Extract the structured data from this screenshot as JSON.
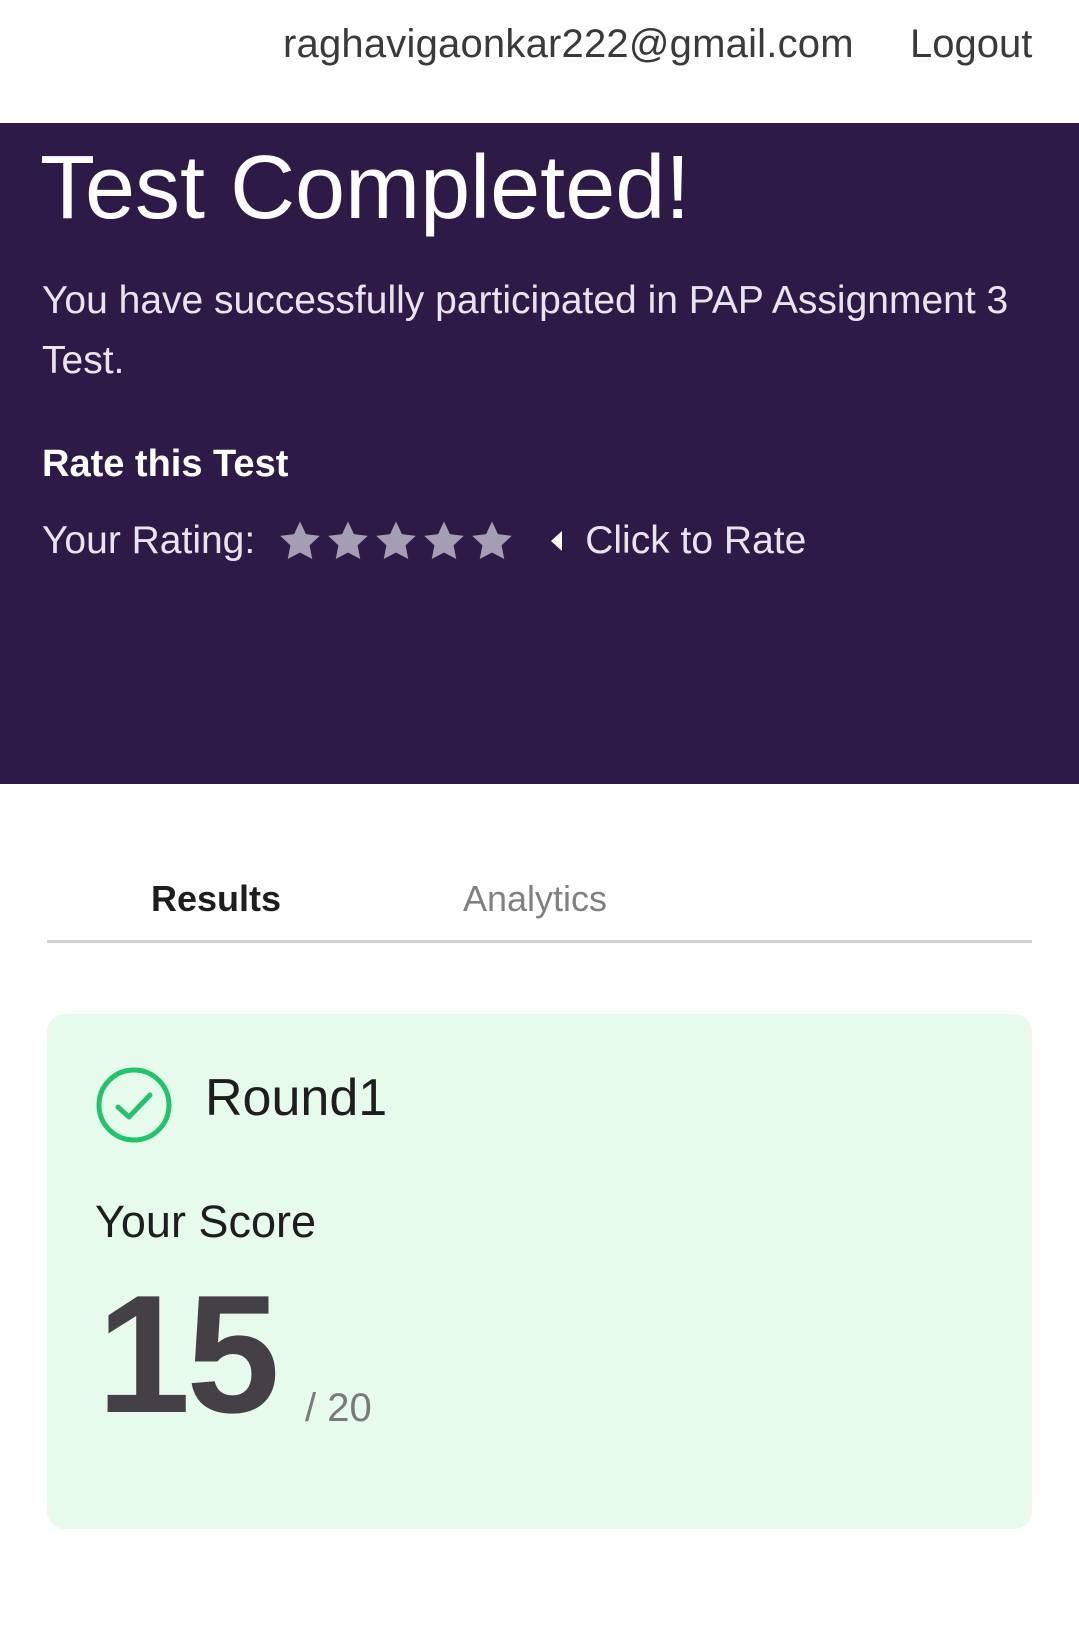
{
  "header": {
    "user_email": "raghavigaonkar222@gmail.com",
    "logout_label": "Logout"
  },
  "hero": {
    "title": "Test Completed!",
    "subtitle": "You have successfully participated in PAP Assignment 3 Test.",
    "rate_heading": "Rate this Test",
    "rating_label": "Your Rating:",
    "rating_value": 0,
    "rating_max": 5,
    "click_to_rate_label": "Click to Rate",
    "star_color": "#a59db3",
    "background_color": "#2e1a47"
  },
  "tabs": [
    {
      "label": "Results",
      "active": true
    },
    {
      "label": "Analytics",
      "active": false
    }
  ],
  "result_card": {
    "round_name": "Round1",
    "status_icon": "check-circle-icon",
    "status_color": "#22c36b",
    "score_label": "Your Score",
    "score": "15",
    "score_total": "/ 20",
    "background_color": "#e6fbec"
  }
}
